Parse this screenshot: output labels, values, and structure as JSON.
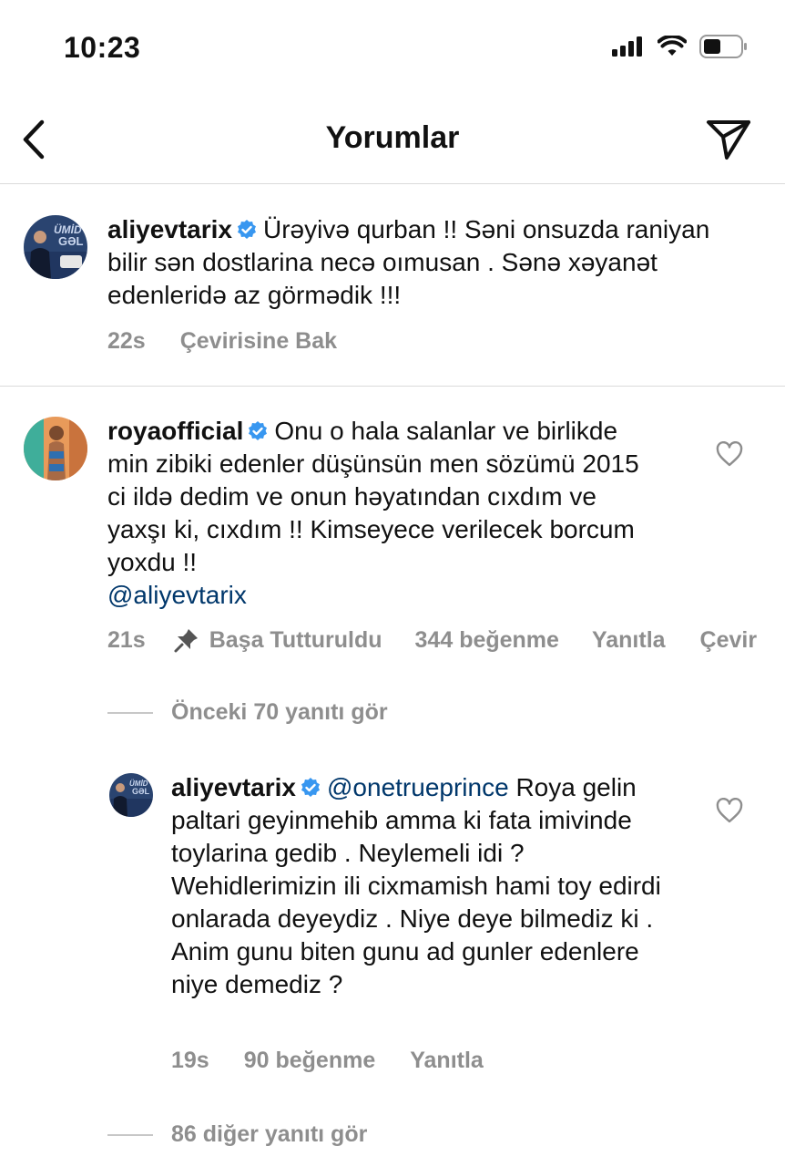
{
  "status_bar": {
    "time": "10:23"
  },
  "header": {
    "title": "Yorumlar"
  },
  "comments": [
    {
      "username": "aliyevtarix",
      "text": "Ürəyivə qurban !! Səni onsuzda raniyan bilir sən dostlarina necə oımusan . Sənə xəyanət edenleridə az görmədik !!!",
      "time": "22s",
      "translate": "Çevirisine Bak"
    },
    {
      "username": "royaofficial",
      "text": "Onu o hala salanlar ve birlikde min zibiki edenler düşünsün men sözümü 2015 ci ildə dedim ve onun həyatından cıxdım ve yaxşı ki, cıxdım !! Kimseyece verilecek borcum yoxdu !!",
      "mention": "@aliyevtarix",
      "time": "21s",
      "pinned": "Başa Tutturuldu",
      "likes": "344 beğenme",
      "reply": "Yanıtla",
      "translate": "Çevir"
    }
  ],
  "previous_replies": "Önceki 70 yanıtı gör",
  "reply_comment": {
    "username": "aliyevtarix",
    "mention": "@onetrueprince",
    "text": "Roya gelin paltari geyinmehib amma ki fata imivinde toylarina gedib . Neylemeli idi ? Wehidlerimizin ili cixmamish hami toy edirdi onlarada deyeydiz . Niye deye bilmediz ki . Anim gunu biten gunu ad gunler edenlere niye demediz ?",
    "time": "19s",
    "likes": "90 beğenme",
    "reply": "Yanıtla"
  },
  "more_replies": "86 diğer yanıtı gör",
  "icons": {
    "back": "chevron-left-icon",
    "send": "paper-plane-icon",
    "verified": "verified-badge-icon",
    "heart": "heart-outline-icon",
    "pin": "pin-icon"
  },
  "colors": {
    "verified": "#3897f0",
    "meta": "#8e8e8e",
    "mention": "#00376b"
  }
}
